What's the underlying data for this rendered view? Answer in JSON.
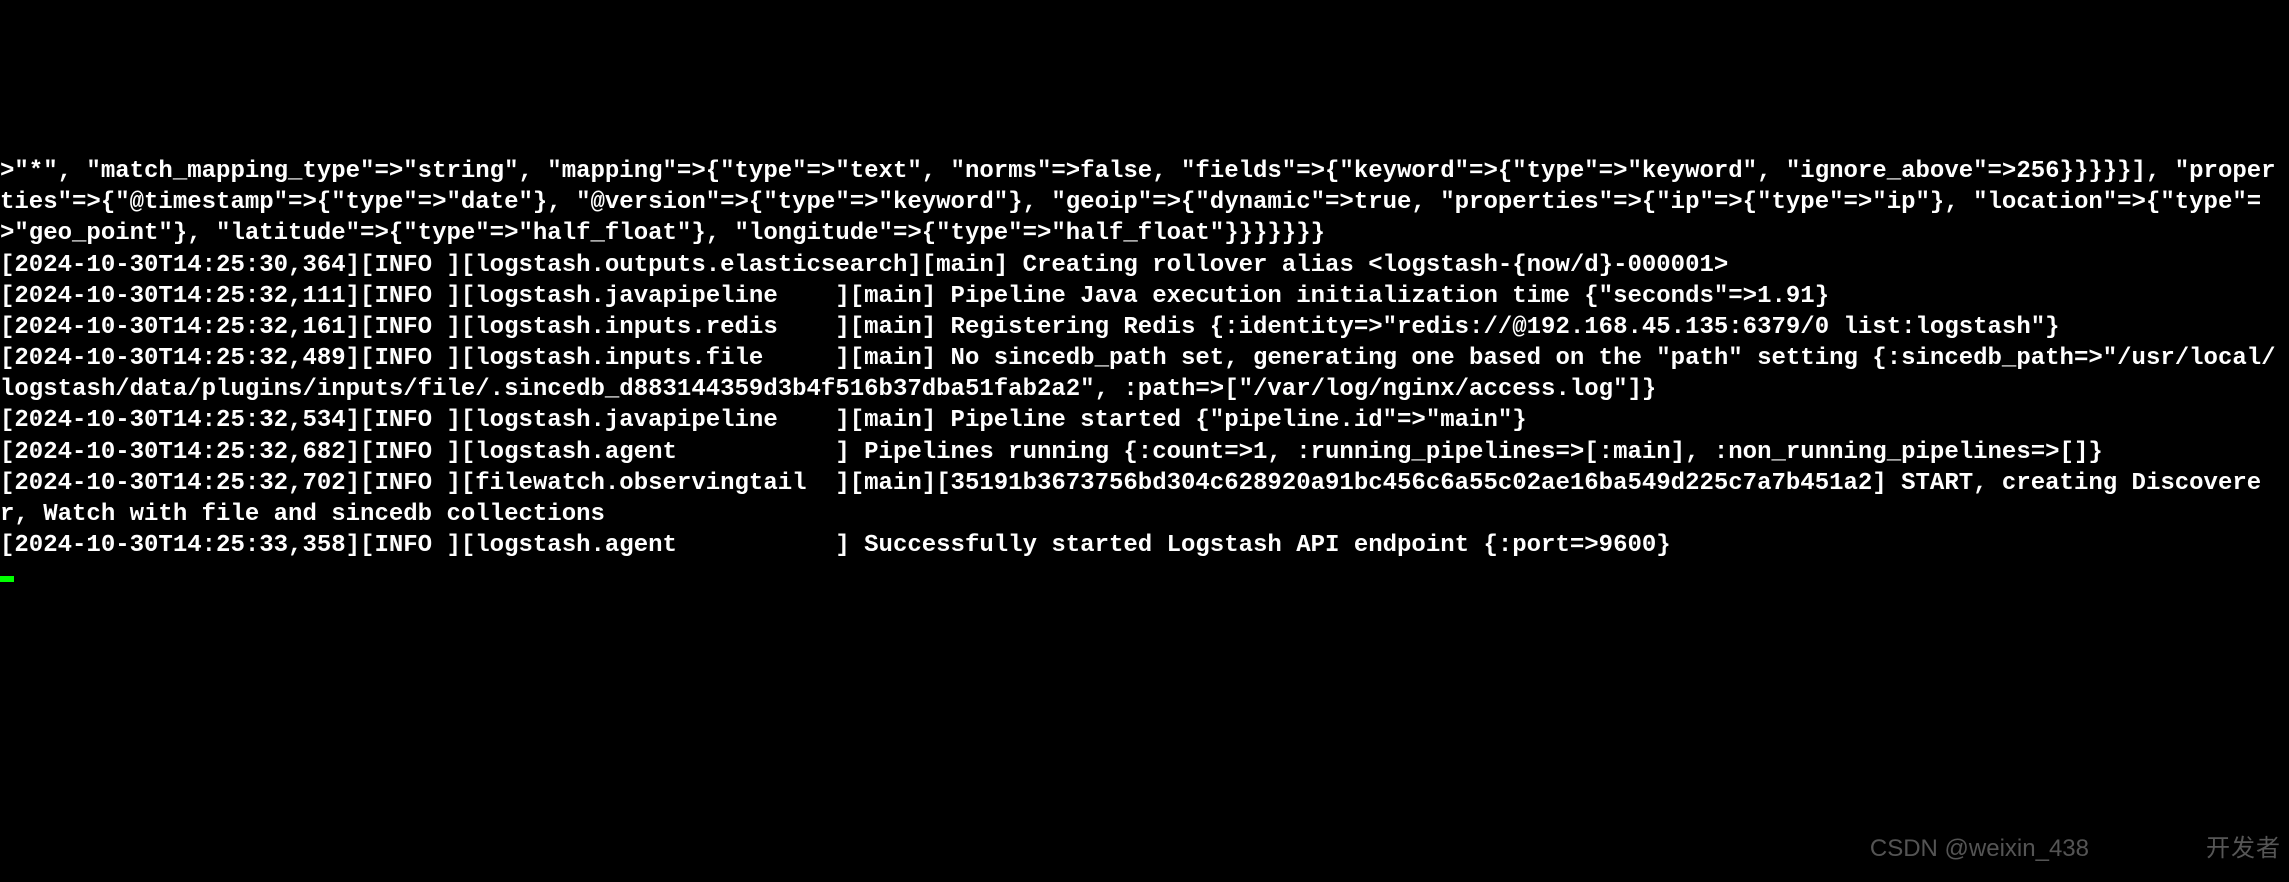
{
  "terminal": {
    "lines": [
      ">\"*\", \"match_mapping_type\"=>\"string\", \"mapping\"=>{\"type\"=>\"text\", \"norms\"=>false, \"fields\"=>{\"keyword\"=>{\"type\"=>\"keyword\", \"ignore_above\"=>256}}}}}], \"properties\"=>{\"@timestamp\"=>{\"type\"=>\"date\"}, \"@version\"=>{\"type\"=>\"keyword\"}, \"geoip\"=>{\"dynamic\"=>true, \"properties\"=>{\"ip\"=>{\"type\"=>\"ip\"}, \"location\"=>{\"type\"=>\"geo_point\"}, \"latitude\"=>{\"type\"=>\"half_float\"}, \"longitude\"=>{\"type\"=>\"half_float\"}}}}}}}",
      "[2024-10-30T14:25:30,364][INFO ][logstash.outputs.elasticsearch][main] Creating rollover alias <logstash-{now/d}-000001>",
      "[2024-10-30T14:25:32,111][INFO ][logstash.javapipeline    ][main] Pipeline Java execution initialization time {\"seconds\"=>1.91}",
      "[2024-10-30T14:25:32,161][INFO ][logstash.inputs.redis    ][main] Registering Redis {:identity=>\"redis://@192.168.45.135:6379/0 list:logstash\"}",
      "[2024-10-30T14:25:32,489][INFO ][logstash.inputs.file     ][main] No sincedb_path set, generating one based on the \"path\" setting {:sincedb_path=>\"/usr/local/logstash/data/plugins/inputs/file/.sincedb_d883144359d3b4f516b37dba51fab2a2\", :path=>[\"/var/log/nginx/access.log\"]}",
      "[2024-10-30T14:25:32,534][INFO ][logstash.javapipeline    ][main] Pipeline started {\"pipeline.id\"=>\"main\"}",
      "[2024-10-30T14:25:32,682][INFO ][logstash.agent           ] Pipelines running {:count=>1, :running_pipelines=>[:main], :non_running_pipelines=>[]}",
      "[2024-10-30T14:25:32,702][INFO ][filewatch.observingtail  ][main][35191b3673756bd304c628920a91bc456c6a55c02ae16ba549d225c7a7b451a2] START, creating Discoverer, Watch with file and sincedb collections",
      "[2024-10-30T14:25:33,358][INFO ][logstash.agent           ] Successfully started Logstash API endpoint {:port=>9600}"
    ]
  },
  "watermarks": {
    "csdn": "CSDN @weixin_438",
    "developer": "开发者"
  }
}
